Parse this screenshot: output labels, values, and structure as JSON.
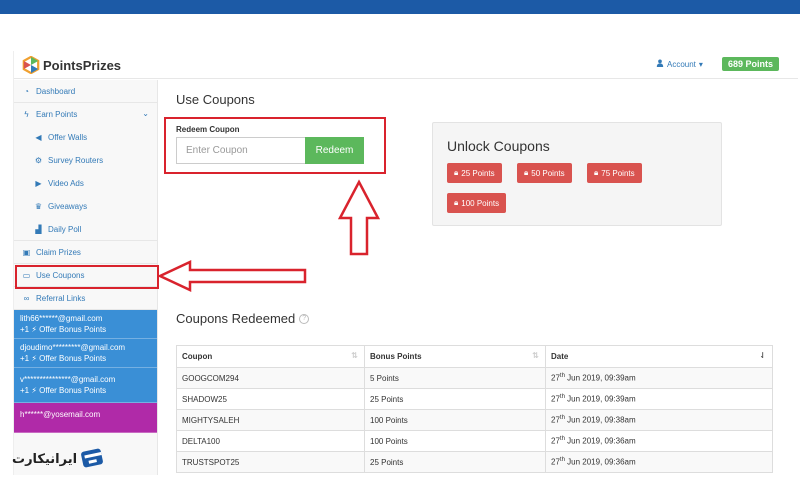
{
  "header": {
    "logo_text": "PointsPrizes",
    "account_label": "Account",
    "points_badge": "689 Points"
  },
  "sidebar": {
    "items": [
      {
        "label": "Dashboard",
        "icon": "dashboard-icon"
      },
      {
        "label": "Earn Points",
        "icon": "bolt-icon"
      },
      {
        "label": "Offer Walls",
        "icon": "megaphone-icon"
      },
      {
        "label": "Survey Routers",
        "icon": "gear-icon"
      },
      {
        "label": "Video Ads",
        "icon": "play-icon"
      },
      {
        "label": "Giveaways",
        "icon": "trophy-icon"
      },
      {
        "label": "Daily Poll",
        "icon": "chart-icon"
      },
      {
        "label": "Claim Prizes",
        "icon": "gift-icon"
      },
      {
        "label": "Use Coupons",
        "icon": "ticket-icon"
      },
      {
        "label": "Referral Links",
        "icon": "link-icon"
      }
    ],
    "feed": [
      {
        "user": "lith66******@gmail.com",
        "action": "+1 ⚡ Offer Bonus Points"
      },
      {
        "user": "djoudimo*********@gmail.com",
        "action": "+1 ⚡ Offer Bonus Points"
      },
      {
        "user": "v***************@gmail.com",
        "action": "+1 ⚡ Offer Bonus Points"
      },
      {
        "user": "h******@yosemail.com",
        "action": ""
      }
    ]
  },
  "main": {
    "title": "Use Coupons",
    "redeem_label": "Redeem Coupon",
    "input_placeholder": "Enter Coupon",
    "redeem_button": "Redeem",
    "unlock_title": "Unlock Coupons",
    "unlock_buttons": [
      "25 Points",
      "50 Points",
      "75 Points",
      "100 Points"
    ],
    "redeemed_title": "Coupons Redeemed",
    "table": {
      "headers": [
        "Coupon",
        "Bonus Points",
        "Date"
      ],
      "rows": [
        {
          "coupon": "GOOGCOM294",
          "points": "5 Points",
          "day": "27",
          "sup": "th",
          "rest": " Jun 2019, 09:39am"
        },
        {
          "coupon": "SHADOW25",
          "points": "25 Points",
          "day": "27",
          "sup": "th",
          "rest": " Jun 2019, 09:39am"
        },
        {
          "coupon": "MIGHTYSALEH",
          "points": "100 Points",
          "day": "27",
          "sup": "th",
          "rest": " Jun 2019, 09:38am"
        },
        {
          "coupon": "DELTA100",
          "points": "100 Points",
          "day": "27",
          "sup": "th",
          "rest": " Jun 2019, 09:36am"
        },
        {
          "coupon": "TRUSTSPOT25",
          "points": "25 Points",
          "day": "27",
          "sup": "th",
          "rest": " Jun 2019, 09:36am"
        }
      ]
    }
  },
  "watermark": {
    "text": "ایرانیکارت"
  },
  "colors": {
    "accent": "#337ab7",
    "success": "#5cb85c",
    "danger": "#d9534f",
    "annotation": "#d9232d",
    "topbar": "#1c5aa6"
  }
}
